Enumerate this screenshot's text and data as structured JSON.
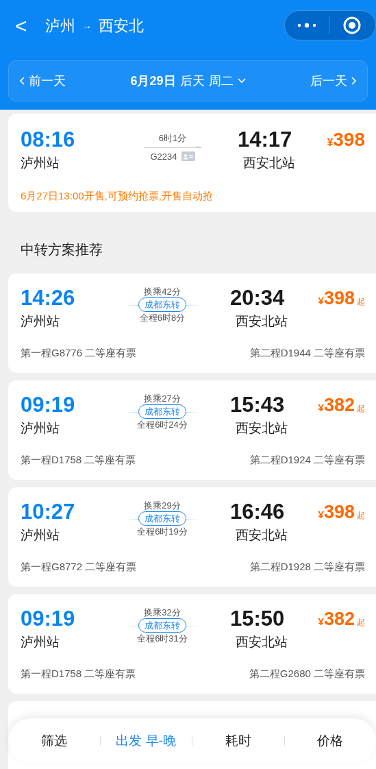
{
  "header": {
    "back": "<",
    "from": "泸州",
    "arrow": "→",
    "to": "西安北"
  },
  "date_bar": {
    "prev": "前一天",
    "date": "6月29日",
    "day": "后天",
    "weekday": "周二",
    "next": "后一天"
  },
  "direct": {
    "depart_time": "08:16",
    "depart_station": "泸州站",
    "duration": "6时1分",
    "train": "G2234",
    "arrive_time": "14:17",
    "arrive_station": "西安北站",
    "price_symbol": "¥",
    "price": "398",
    "notice": "6月27日13:00开售,可预约抢票,开售自动抢"
  },
  "section_title": "中转方案推荐",
  "transfers": [
    {
      "depart_time": "14:26",
      "depart_station": "泸州站",
      "wait": "换乘42分",
      "via": "成都东转",
      "total": "全程6时8分",
      "arrive_time": "20:34",
      "arrive_station": "西安北站",
      "price_symbol": "¥",
      "price": "398",
      "suffix": "起",
      "leg1": "第一程G8776 二等座有票",
      "leg2": "第二程D1944 二等座有票"
    },
    {
      "depart_time": "09:19",
      "depart_station": "泸州站",
      "wait": "换乘27分",
      "via": "成都东转",
      "total": "全程6时24分",
      "arrive_time": "15:43",
      "arrive_station": "西安北站",
      "price_symbol": "¥",
      "price": "382",
      "suffix": "起",
      "leg1": "第一程D1758 二等座有票",
      "leg2": "第二程D1924 二等座有票"
    },
    {
      "depart_time": "10:27",
      "depart_station": "泸州站",
      "wait": "换乘29分",
      "via": "成都东转",
      "total": "全程6时19分",
      "arrive_time": "16:46",
      "arrive_station": "西安北站",
      "price_symbol": "¥",
      "price": "398",
      "suffix": "起",
      "leg1": "第一程G8772 二等座有票",
      "leg2": "第二程D1928 二等座有票"
    },
    {
      "depart_time": "09:19",
      "depart_station": "泸州站",
      "wait": "换乘32分",
      "via": "成都东转",
      "total": "全程6时31分",
      "arrive_time": "15:50",
      "arrive_station": "西安北站",
      "price_symbol": "¥",
      "price": "382",
      "suffix": "起",
      "leg1": "第一程D1758 二等座有票",
      "leg2": "第二程G2680 二等座有票"
    }
  ],
  "sort_bar": [
    {
      "label": "筛选",
      "selected": false
    },
    {
      "label": "出发 早-晚",
      "selected": true
    },
    {
      "label": "耗时",
      "selected": false
    },
    {
      "label": "价格",
      "selected": false
    }
  ]
}
